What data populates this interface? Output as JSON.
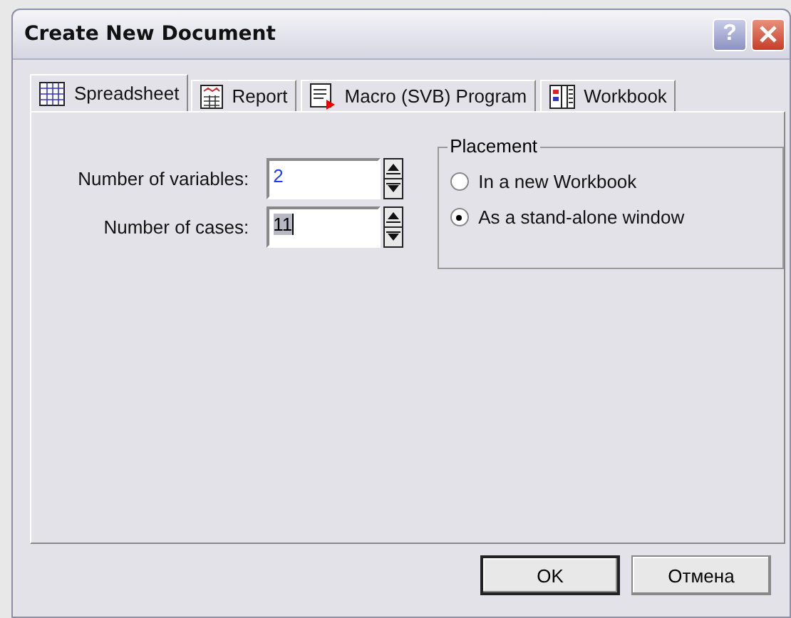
{
  "window": {
    "title": "Create New Document",
    "buttons": [
      "?"
    ]
  },
  "tabs": [
    {
      "label": "Spreadsheet",
      "selected": true,
      "kind": "grid"
    },
    {
      "label": "Report",
      "selected": false,
      "kind": "report"
    },
    {
      "label": "Macro (SVB) Program",
      "selected": false,
      "kind": "macro"
    },
    {
      "label": "Workbook",
      "selected": false,
      "kind": "workbook"
    }
  ],
  "fields": [
    {
      "label": "Number of variables:",
      "value": "2",
      "selected": false
    },
    {
      "label": "Number of cases:",
      "value": "11",
      "selected": true
    }
  ],
  "placement": {
    "title": "Placement",
    "options": [
      {
        "label": "In a new Workbook",
        "selected": false
      },
      {
        "label": "As a stand-alone window",
        "selected": true
      }
    ]
  },
  "buttons": [
    {
      "label": "OK",
      "default": true
    },
    {
      "label": "Отмена",
      "default": false
    }
  ]
}
